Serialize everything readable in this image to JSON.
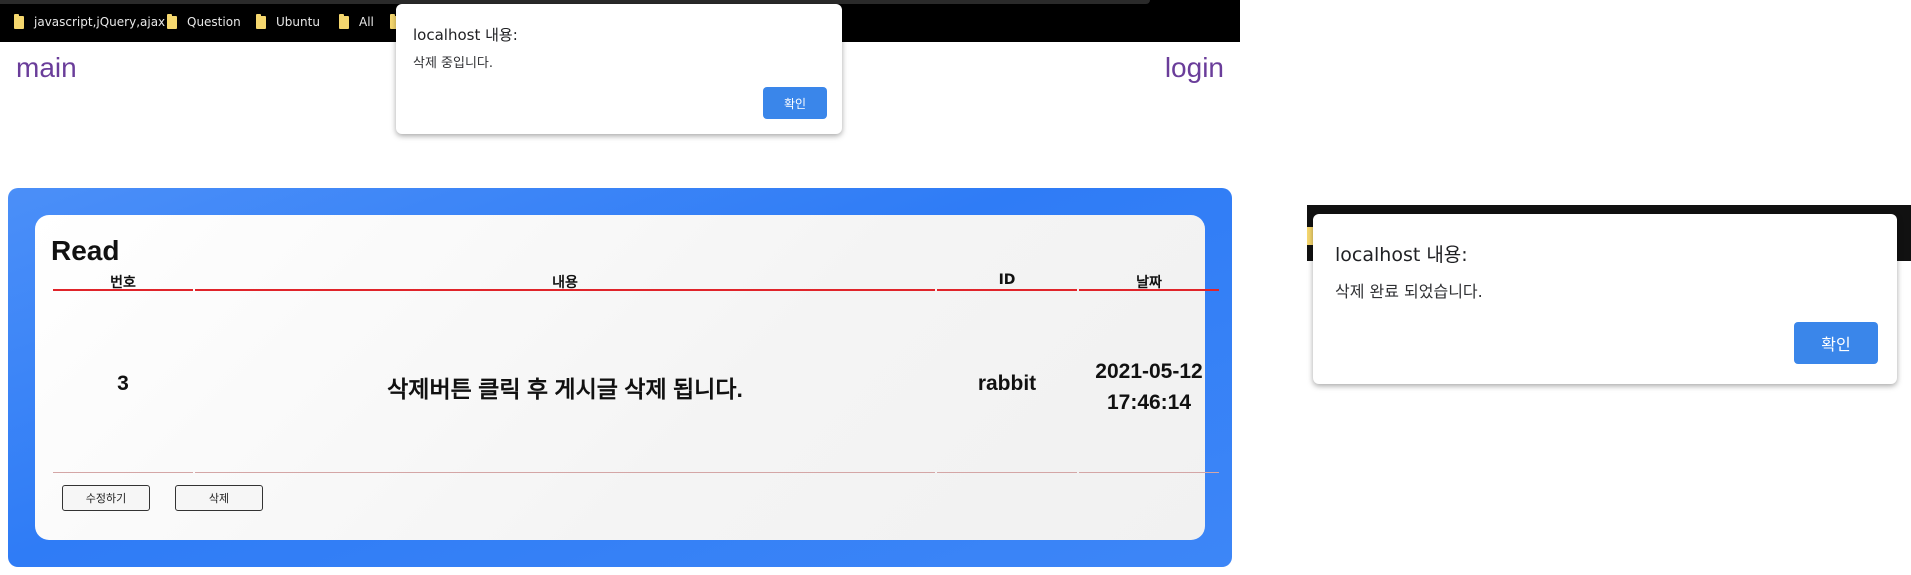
{
  "bookmarks": [
    {
      "label": "javascript,jQuery,ajax",
      "icon": "folder-icon"
    },
    {
      "label": "Question",
      "icon": "folder-icon"
    },
    {
      "label": "Ubuntu",
      "icon": "folder-icon"
    },
    {
      "label": "All",
      "icon": "folder-icon"
    }
  ],
  "nav": {
    "main": "main",
    "login": "login"
  },
  "card": {
    "title": "Read",
    "columns": [
      "번호",
      "내용",
      "ID",
      "날짜"
    ],
    "row": {
      "number": "3",
      "content": "삭제버튼 클릭 후 게시글 삭제 됩니다.",
      "id": "rabbit",
      "date_line1": "2021-05-12",
      "date_line2": "17:46:14"
    },
    "buttons": {
      "edit": "수정하기",
      "delete": "삭제"
    }
  },
  "dialog_deleting": {
    "title": "localhost 내용:",
    "message": "삭제 중입니다.",
    "ok": "확인"
  },
  "dialog_deleted": {
    "title": "localhost 내용:",
    "message": "삭제 완료 되었습니다.",
    "ok": "확인"
  },
  "colors": {
    "accent_blue": "#3a86ea",
    "header_line": "#e0242a",
    "nav_link": "#6a3d9a"
  }
}
